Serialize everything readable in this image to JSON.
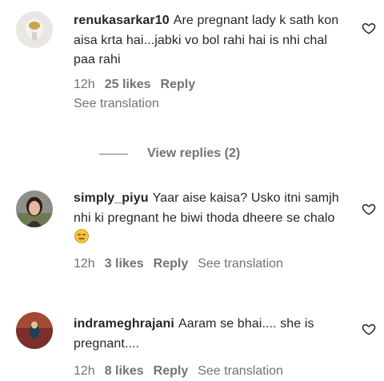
{
  "comments": [
    {
      "username": "renukasarkar10",
      "text": "Are pregnant lady k sath kon aisa krta hai...jabki vo bol rahi hai is nhi chal paa rahi",
      "time": "12h",
      "likes": "25 likes",
      "reply": "Reply",
      "translation": "See translation",
      "view_replies": "View replies (2)"
    },
    {
      "username": "simply_piyu",
      "text": "Yaar aise kaisa? Usko itni samjh nhi ki pregnant he biwi thoda dheere se chalo",
      "emoji": "😑",
      "time": "12h",
      "likes": "3 likes",
      "reply": "Reply",
      "translation": "See translation"
    },
    {
      "username": "indrameghrajani",
      "text": "Aaram se bhai.... she is pregnant....",
      "time": "12h",
      "likes": "8 likes",
      "reply": "Reply",
      "translation": "See translation"
    }
  ],
  "icons": {
    "like": "heart-outline-icon",
    "emoji": "expressionless-face-emoji"
  },
  "colors": {
    "text": "#262626",
    "secondary": "#737373",
    "background": "#ffffff",
    "emoji_yellow": "#f6c33b"
  }
}
